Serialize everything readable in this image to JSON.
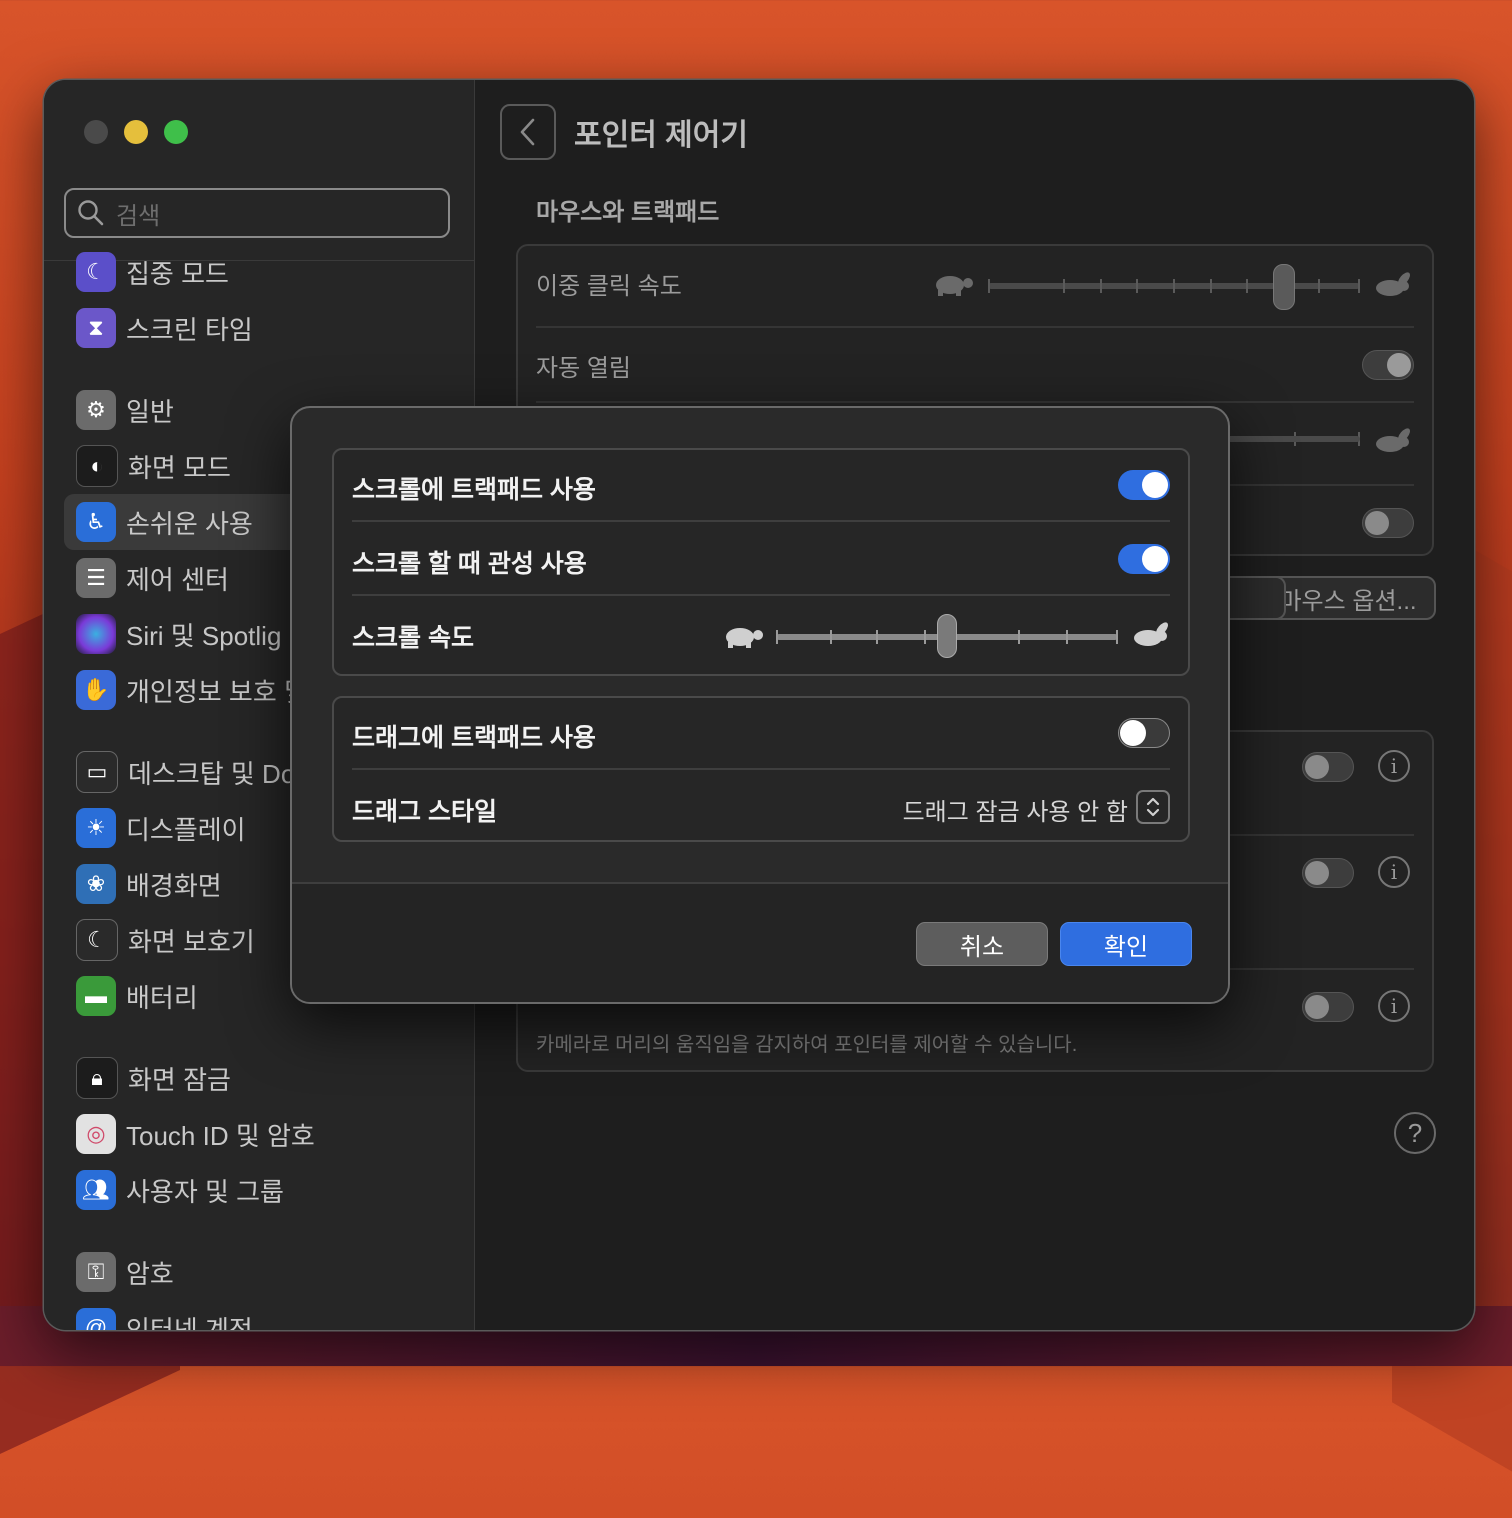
{
  "window": {
    "title": "포인터 제어기"
  },
  "sidebar": {
    "search_placeholder": "검색",
    "items": [
      {
        "label": "집중 모드",
        "icon": "moon-icon",
        "color": "#5b4fc9"
      },
      {
        "label": "스크린 타임",
        "icon": "hourglass-icon",
        "color": "#6b57c9"
      },
      {
        "label": "일반",
        "icon": "gear-icon",
        "color": "#6b6b6b"
      },
      {
        "label": "화면 모드",
        "icon": "appearance-icon",
        "color": "#1c1c1c"
      },
      {
        "label": "손쉬운 사용",
        "icon": "accessibility-icon",
        "color": "#2a6ed8"
      },
      {
        "label": "제어 센터",
        "icon": "control-center-icon",
        "color": "#6b6b6b"
      },
      {
        "label": "Siri 및 Spotlig",
        "icon": "siri-icon",
        "color": "#3a2f6a"
      },
      {
        "label": "개인정보 보호 및",
        "icon": "hand-icon",
        "color": "#3a6ad8"
      },
      {
        "label": "데스크탑 및 Do",
        "icon": "dock-icon",
        "color": "#2a2a2a"
      },
      {
        "label": "디스플레이",
        "icon": "display-icon",
        "color": "#2a6ed8"
      },
      {
        "label": "배경화면",
        "icon": "flower-icon",
        "color": "#2f6fb6"
      },
      {
        "label": "화면 보호기",
        "icon": "screensaver-icon",
        "color": "#2a2a2a"
      },
      {
        "label": "배터리",
        "icon": "battery-icon",
        "color": "#3a9a3a"
      },
      {
        "label": "화면 잠금",
        "icon": "lock-icon",
        "color": "#1c1c1c"
      },
      {
        "label": "Touch ID 및 암호",
        "icon": "fingerprint-icon",
        "color": "#e2e2e2"
      },
      {
        "label": "사용자 및 그룹",
        "icon": "users-icon",
        "color": "#2a6ed8"
      },
      {
        "label": "암호",
        "icon": "key-icon",
        "color": "#6b6b6b"
      },
      {
        "label": "인터넷 계정",
        "icon": "at-icon",
        "color": "#2a6ed8"
      }
    ]
  },
  "main": {
    "title": "포인터 제어기",
    "section": "마우스와 트랙패드",
    "double_click_label": "이중 클릭 속도",
    "spring_loading_label": "자동 열림",
    "mouse_options_label": "마우스 옵션...",
    "head_pointer_caption": "카메라로 머리의 움직임을 감지하여 포인터를 제어할 수 있습니다.",
    "help_label": "?"
  },
  "dialog": {
    "scroll_trackpad_label": "스크롤에 트랙패드 사용",
    "scroll_trackpad_on": true,
    "inertia_label": "스크롤 할 때 관성 사용",
    "inertia_on": true,
    "scroll_speed_label": "스크롤 속도",
    "scroll_speed_value": 0.5,
    "drag_trackpad_label": "드래그에 트랙패드 사용",
    "drag_trackpad_on": false,
    "drag_style_label": "드래그 스타일",
    "drag_style_value": "드래그 잠금 사용 안 함",
    "cancel_label": "취소",
    "ok_label": "확인"
  },
  "colors": {
    "accent": "#2f6ee0",
    "window_bg": "#1e1e1e",
    "sidebar_bg": "#262626"
  }
}
